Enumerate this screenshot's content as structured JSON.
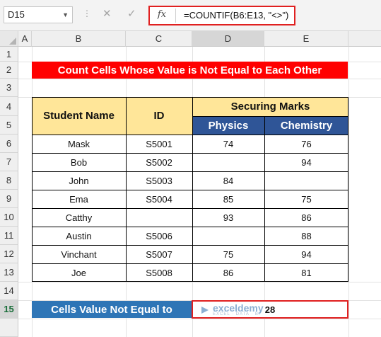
{
  "formula_bar": {
    "name_box": "D15",
    "cancel_icon": "✕",
    "enter_icon": "✓",
    "fx_label": "fx",
    "formula": "=COUNTIF(B6:E13, \"<>\")"
  },
  "columns": [
    "A",
    "B",
    "C",
    "D",
    "E"
  ],
  "rows": [
    "1",
    "2",
    "3",
    "4",
    "5",
    "6",
    "7",
    "8",
    "9",
    "10",
    "11",
    "12",
    "13",
    "14",
    "15"
  ],
  "title": "Count Cells Whose Value is Not Equal to Each Other",
  "table": {
    "header_name": "Student Name",
    "header_id": "ID",
    "header_marks": "Securing Marks",
    "header_physics": "Physics",
    "header_chemistry": "Chemistry",
    "rows": [
      {
        "name": "Mask",
        "id": "S5001",
        "physics": "74",
        "chemistry": "76"
      },
      {
        "name": "Bob",
        "id": "S5002",
        "physics": "",
        "chemistry": "94"
      },
      {
        "name": "John",
        "id": "S5003",
        "physics": "84",
        "chemistry": ""
      },
      {
        "name": "Ema",
        "id": "S5004",
        "physics": "85",
        "chemistry": "75"
      },
      {
        "name": "Catthy",
        "id": "",
        "physics": "93",
        "chemistry": "86"
      },
      {
        "name": "Austin",
        "id": "S5006",
        "physics": "",
        "chemistry": "88"
      },
      {
        "name": "Vinchant",
        "id": "S5007",
        "physics": "75",
        "chemistry": "94"
      },
      {
        "name": "Joe",
        "id": "S5008",
        "physics": "86",
        "chemistry": "81"
      }
    ]
  },
  "result": {
    "label": "Cells Value Not Equal to",
    "value": "28"
  },
  "watermark": {
    "brand": "exceldemy",
    "tagline": "EXCEL · DATA · BI"
  },
  "colors": {
    "title_bg": "#ff0000",
    "header_yellow": "#ffe699",
    "header_blue": "#2f5597",
    "result_label_bg": "#2e75b6",
    "highlight_border": "#e02020"
  }
}
